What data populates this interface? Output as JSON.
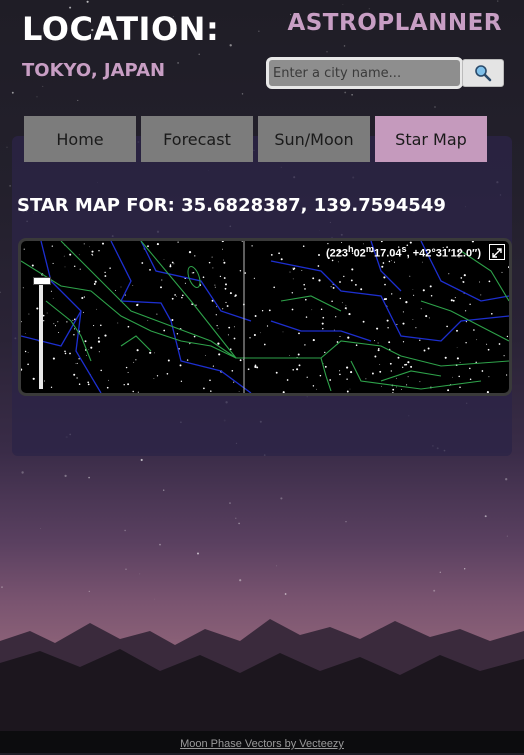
{
  "header": {
    "location_title": "LOCATION:",
    "location_city": "TOKYO, JAPAN",
    "brand": "ASTROPLANNER"
  },
  "search": {
    "placeholder": "Enter a city name...",
    "value": "",
    "button_icon": "search-icon"
  },
  "tabs": [
    {
      "label": "Home",
      "active": false
    },
    {
      "label": "Forecast",
      "active": false
    },
    {
      "label": "Sun/Moon",
      "active": false
    },
    {
      "label": "Star Map",
      "active": true
    }
  ],
  "starmap": {
    "title": "STAR MAP FOR: 35.6828387, 139.7594549",
    "coord_ra_h": "223",
    "coord_ra_m": "02",
    "coord_ra_s": "17.04",
    "coord_dec": "+42°31′12.0″",
    "fullscreen_icon": "fullscreen-icon"
  },
  "footer": {
    "credit": "Moon Phase Vectors by Vecteezy"
  },
  "colors": {
    "accent": "#c89ec4",
    "tab_active": "#c59abd",
    "tab_inactive": "#7c7c7c",
    "panel": "#2c2446"
  }
}
